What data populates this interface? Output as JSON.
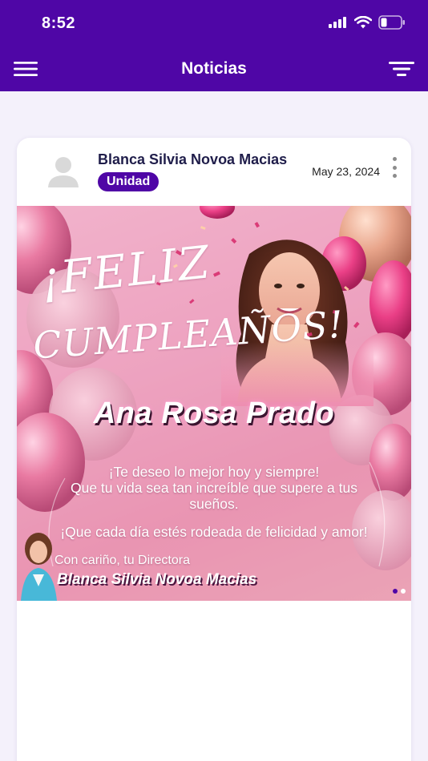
{
  "status_bar": {
    "time": "8:52"
  },
  "header": {
    "title": "Noticias"
  },
  "post": {
    "author": "Blanca Silvia Novoa Macias",
    "badge": "Unidad",
    "date": "May 23, 2024",
    "image": {
      "feliz": "¡FELIZ",
      "cumpleanos": "CUMPLEAÑOS!",
      "name": "Ana Rosa Prado",
      "message_line1": "¡Te deseo lo mejor hoy y siempre!",
      "message_line2": "Que tu vida sea tan increíble que supere a tus",
      "message_line3": "sueños.",
      "message_line4": "¡Que cada día estés rodeada de felicidad y amor!",
      "sign_line1": "Con cariño, tu Directora",
      "sign_line2": "Blanca Silvia Novoa Macias"
    },
    "carousel": {
      "count": 2,
      "active": 1
    }
  },
  "colors": {
    "brand": "#4f06a6",
    "card_bg": "#ffffff",
    "page_bg": "#f4f1fb",
    "dot_active": "#4f06a6",
    "dot_inactive": "#ffffff"
  },
  "icons": [
    "signal-icon",
    "wifi-icon",
    "battery-icon",
    "hamburger-menu-icon",
    "filter-icon",
    "default-avatar-icon",
    "more-vertical-icon"
  ]
}
